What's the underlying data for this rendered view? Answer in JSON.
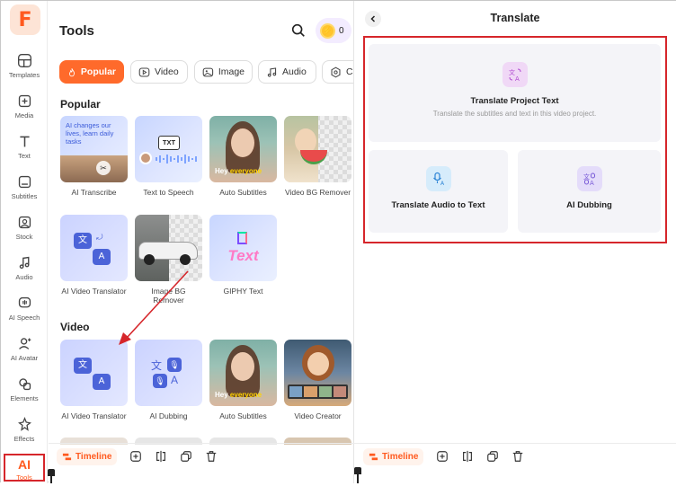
{
  "rail": {
    "logo": "F",
    "items": [
      {
        "label": "Templates",
        "icon": "templates-icon"
      },
      {
        "label": "Media",
        "icon": "media-icon"
      },
      {
        "label": "Text",
        "icon": "text-icon"
      },
      {
        "label": "Subtitles",
        "icon": "subtitles-icon"
      },
      {
        "label": "Stock",
        "icon": "stock-icon"
      },
      {
        "label": "Audio",
        "icon": "audio-icon"
      },
      {
        "label": "AI Speech",
        "icon": "ai-speech-icon"
      },
      {
        "label": "AI Avatar",
        "icon": "ai-avatar-icon"
      },
      {
        "label": "Elements",
        "icon": "elements-icon"
      },
      {
        "label": "Effects",
        "icon": "effects-icon"
      },
      {
        "label": "Tools",
        "icon": "ai-tools-icon",
        "glyph": "AI"
      }
    ]
  },
  "tools": {
    "title": "Tools",
    "credits": "0",
    "categories": [
      {
        "label": "Popular",
        "active": true
      },
      {
        "label": "Video",
        "active": false
      },
      {
        "label": "Image",
        "active": false
      },
      {
        "label": "Audio",
        "active": false
      },
      {
        "label": "C",
        "active": false
      }
    ],
    "sections": {
      "popular": "Popular",
      "video": "Video"
    },
    "popular_items": [
      {
        "label": "AI Transcribe",
        "thumb_text": "AI changes our lives, learn daily tasks"
      },
      {
        "label": "Text to Speech",
        "thumb_text": "TXT"
      },
      {
        "label": "Auto Subtitles",
        "caption_a": "Hey",
        "caption_b": "everyone"
      },
      {
        "label": "Video BG Remover"
      },
      {
        "label": "AI Video Translator",
        "glyph_a": "文",
        "glyph_b": "A"
      },
      {
        "label": "Image BG Remover"
      },
      {
        "label": "GIPHY Text",
        "thumb_text": "Text"
      }
    ],
    "video_items": [
      {
        "label": "AI Video Translator",
        "glyph_a": "文",
        "glyph_b": "A"
      },
      {
        "label": "AI Dubbing",
        "glyph_a": "文",
        "glyph_b": "A"
      },
      {
        "label": "Auto Subtitles",
        "caption_a": "Hey",
        "caption_b": "everyone"
      },
      {
        "label": "Video Creator"
      }
    ]
  },
  "bottom_bar": {
    "timeline_label": "Timeline"
  },
  "translate": {
    "title": "Translate",
    "project_title": "Translate Project Text",
    "project_desc": "Translate the subtitles and text in this video project.",
    "audio_title": "Translate Audio to Text",
    "dubbing_title": "AI Dubbing"
  },
  "colors": {
    "accent": "#ff5a1f",
    "highlight_red": "#d6262b"
  }
}
